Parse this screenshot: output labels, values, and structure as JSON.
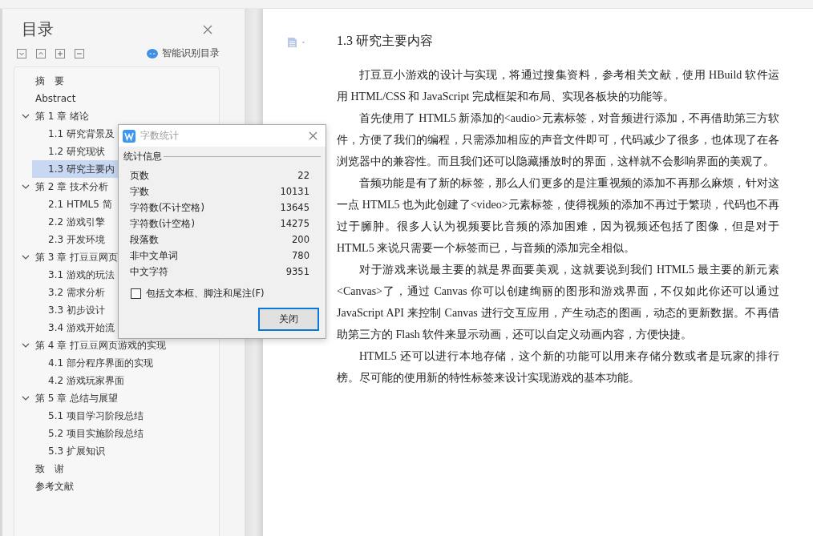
{
  "sidebar": {
    "title": "目录",
    "smart_toc": "智能识别目录",
    "toc": [
      {
        "label": "摘　要",
        "selected": false
      },
      {
        "label": "Abstract",
        "selected": false
      },
      {
        "label": "第 1 章  绪论",
        "selected": false,
        "expanded": true,
        "children": [
          {
            "label": "1.1 研究背景及",
            "selected": false
          },
          {
            "label": "1.2 研究现状",
            "selected": false
          },
          {
            "label": "1.3 研究主要内",
            "selected": true
          }
        ]
      },
      {
        "label": "第 2 章  技术分析",
        "selected": false,
        "expanded": true,
        "children": [
          {
            "label": "2.1 HTML5 简",
            "selected": false
          },
          {
            "label": "2.2 游戏引擎",
            "selected": false
          },
          {
            "label": "2.3 开发环境",
            "selected": false
          }
        ]
      },
      {
        "label": "第 3 章  打豆豆网页",
        "selected": false,
        "expanded": true,
        "children": [
          {
            "label": "3.1 游戏的玩法",
            "selected": false
          },
          {
            "label": "3.2 需求分析",
            "selected": false
          },
          {
            "label": "3.3 初步设计",
            "selected": false
          },
          {
            "label": "3.4 游戏开始流",
            "selected": false
          }
        ]
      },
      {
        "label": "第 4 章  打豆豆网页游戏的实现",
        "selected": false,
        "expanded": true,
        "children": [
          {
            "label": "4.1 部分程序界面的实现",
            "selected": false
          },
          {
            "label": "4.2 游戏玩家界面",
            "selected": false
          }
        ]
      },
      {
        "label": "第 5 章  总结与展望",
        "selected": false,
        "expanded": true,
        "children": [
          {
            "label": "5.1 项目学习阶段总结",
            "selected": false
          },
          {
            "label": "5.2 项目实施阶段总结",
            "selected": false
          },
          {
            "label": "5.3 扩展知识",
            "selected": false
          }
        ]
      },
      {
        "label": "致　谢",
        "selected": false
      },
      {
        "label": "参考文献",
        "selected": false
      }
    ]
  },
  "dialog": {
    "title": "字数统计",
    "group": "统计信息",
    "stats": [
      {
        "label": "页数",
        "value": "22"
      },
      {
        "label": "字数",
        "value": "10131"
      },
      {
        "label": "字符数(不计空格)",
        "value": "13645"
      },
      {
        "label": "字符数(计空格)",
        "value": "14275"
      },
      {
        "label": "段落数",
        "value": "200"
      },
      {
        "label": "非中文单词",
        "value": "780"
      },
      {
        "label": "中文字符",
        "value": "9351"
      }
    ],
    "checkbox": {
      "label": "包括文本框、脚注和尾注(F)",
      "checked": false
    },
    "button": "关闭"
  },
  "document": {
    "heading": "1.3 研究主要内容",
    "paragraphs": [
      "打豆豆小游戏的设计与实现，将通过搜集资料，参考相关文献，使用 HBuild 软件运用 HTML/CSS 和 JavaScript 完成框架和布局、实现各板块的功能等。",
      "首先使用了 HTML5 新添加的<audio>元素标签，对音频进行添加，不再借助第三方软件，方便了我们的编程，只需添加相应的声音文件即可，代码减少了很多，也体现了在各浏览器中的兼容性。而且我们还可以隐藏播放时的界面，这样就不会影响界面的美观了。",
      "音频功能是有了新的标签，那么人们更多的是注重视频的添加不再那么麻烦，针对这一点 HTML5 也为此创建了<video>元素标签，使得视频的添加不再过于繁琐，代码也不再过于臃肿。很多人认为视频要比音频的添加困难，因为视频还包括了图像，但是对于 HTML5 来说只需要一个标签而已，与音频的添加完全相似。",
      "对于游戏来说最主要的就是界面要美观，这就要说到我们 HTML5 最主要的新元素<Canvas>了，通过 Canvas 你可以创建绚丽的图形和游戏界面，不仅如此你还可以通过 JavaScript API 来控制 Canvas 进行交互应用，产生动态的图画，动态的更新数据。不再借助第三方的 Flash 软件来显示动画，还可以自定义动画内容，方便快捷。",
      "HTML5 还可以进行本地存储，这个新的功能可以用来存储分数或者是玩家的排行榜。尽可能的使用新的特性标签来设计实现游戏的基本功能。"
    ]
  }
}
